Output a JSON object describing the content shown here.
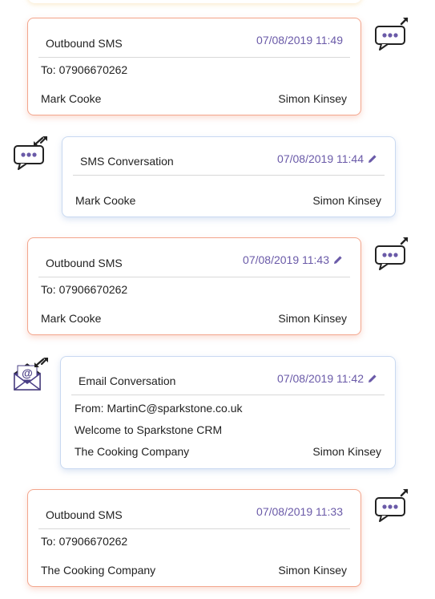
{
  "colors": {
    "outbound_border": "#f3a58c",
    "inbound_border": "#c9d9f1",
    "date_text": "#6a5aa8",
    "icon_purple": "#6a5aa8"
  },
  "timeline": [
    {
      "kind": "outbound",
      "title": "Outbound SMS",
      "date": "07/08/2019 11:49",
      "editable": false,
      "lines": [
        "To: 07906670262"
      ],
      "contact": "Mark Cooke",
      "owner": "Simon Kinsey",
      "icon": "sms-outbound-icon"
    },
    {
      "kind": "inbound",
      "title": "SMS Conversation",
      "date": "07/08/2019 11:44",
      "editable": true,
      "lines": [],
      "contact": "Mark Cooke",
      "owner": "Simon Kinsey",
      "icon": "sms-inbound-icon"
    },
    {
      "kind": "outbound",
      "title": "Outbound SMS",
      "date": "07/08/2019 11:43",
      "editable": true,
      "lines": [
        "To: 07906670262"
      ],
      "contact": "Mark Cooke",
      "owner": "Simon Kinsey",
      "icon": "sms-outbound-icon"
    },
    {
      "kind": "inbound",
      "title": "Email Conversation",
      "date": "07/08/2019 11:42",
      "editable": true,
      "lines": [
        "From: MartinC@sparkstone.co.uk",
        "Welcome to Sparkstone CRM"
      ],
      "contact": "The Cooking Company",
      "owner": "Simon Kinsey",
      "icon": "email-inbound-icon"
    },
    {
      "kind": "outbound",
      "title": "Outbound SMS",
      "date": "07/08/2019 11:33",
      "editable": false,
      "lines": [
        "To: 07906670262"
      ],
      "contact": "The Cooking Company",
      "owner": "Simon Kinsey",
      "icon": "sms-outbound-icon"
    }
  ]
}
